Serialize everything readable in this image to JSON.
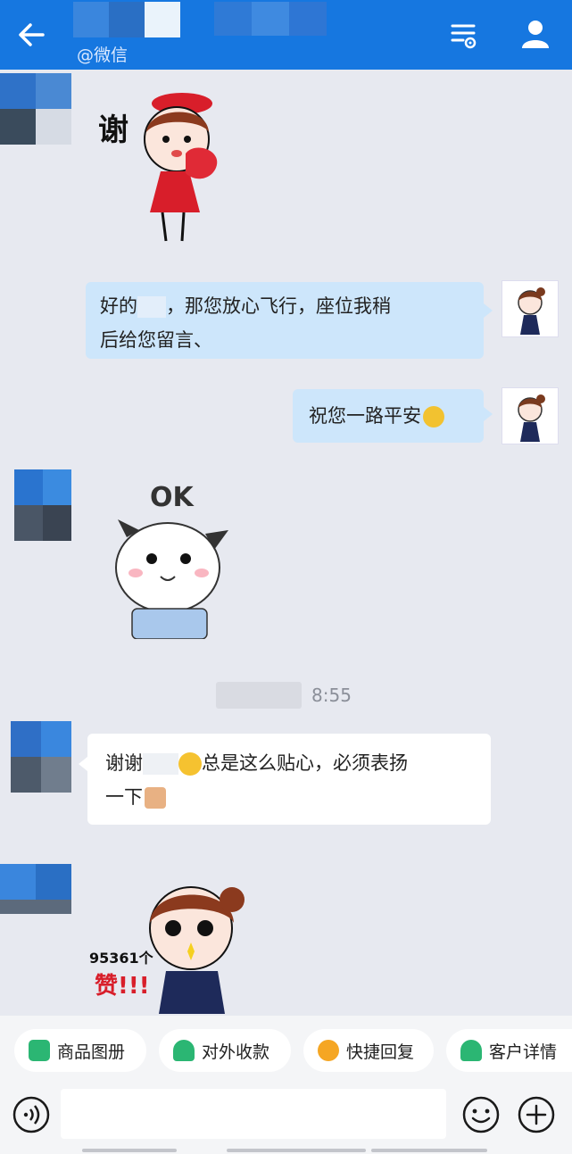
{
  "header": {
    "subtitle": "@微信",
    "back_icon": "arrow-left-icon",
    "menu_icon": "list-settings-icon",
    "profile_icon": "user-icon",
    "color": "#1677e0"
  },
  "messages": {
    "sticker_thanks_char": "谢",
    "out_1_line1": "好的",
    "out_1_line1_tail": "，那您放心飞行，座位我稍",
    "out_1_line2": "后给您留言、",
    "out_2": "祝您一路平安",
    "sticker_ok_text": "OK",
    "timestamp": "8:55",
    "in_2_start": "谢谢",
    "in_2_mid": "总是这么贴心，必须表扬",
    "in_2_line2": "一下",
    "sticker_count": "95361个",
    "sticker_like": "赞!!!"
  },
  "quick_actions": [
    {
      "label": "商品图册",
      "color": "#2bb673"
    },
    {
      "label": "对外收款",
      "color": "#2bb673"
    },
    {
      "label": "快捷回复",
      "color": "#f5a623"
    },
    {
      "label": "客户详情",
      "color": "#2bb673"
    }
  ],
  "input": {
    "voice_icon": "voice-icon",
    "emoji_icon": "emoji-icon",
    "plus_icon": "plus-icon"
  }
}
